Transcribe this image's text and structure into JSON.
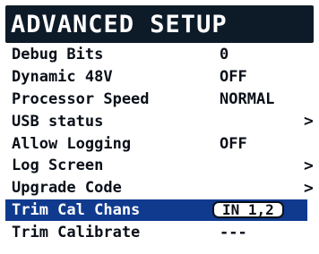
{
  "title": "ADVANCED SETUP",
  "colors": {
    "title_bar": "#0d1a28",
    "selection": "#0f3a8e",
    "text": "#0a0f18",
    "background": "#ffffff"
  },
  "menu": {
    "items": [
      {
        "label": "Debug Bits",
        "value": "0",
        "has_submenu": false
      },
      {
        "label": "Dynamic 48V",
        "value": "OFF",
        "has_submenu": false
      },
      {
        "label": "Processor Speed",
        "value": "NORMAL",
        "has_submenu": false
      },
      {
        "label": "USB status",
        "value": "",
        "has_submenu": true,
        "chevron": ">"
      },
      {
        "label": "Allow Logging",
        "value": "OFF",
        "has_submenu": false
      },
      {
        "label": "Log Screen",
        "value": "",
        "has_submenu": true,
        "chevron": ">"
      },
      {
        "label": "Upgrade Code",
        "value": "",
        "has_submenu": true,
        "chevron": ">"
      },
      {
        "label": "Trim Cal Chans",
        "value": "IN 1,2",
        "has_submenu": false,
        "selected": true
      },
      {
        "label": "Trim Calibrate",
        "value": "---",
        "has_submenu": false
      }
    ]
  }
}
